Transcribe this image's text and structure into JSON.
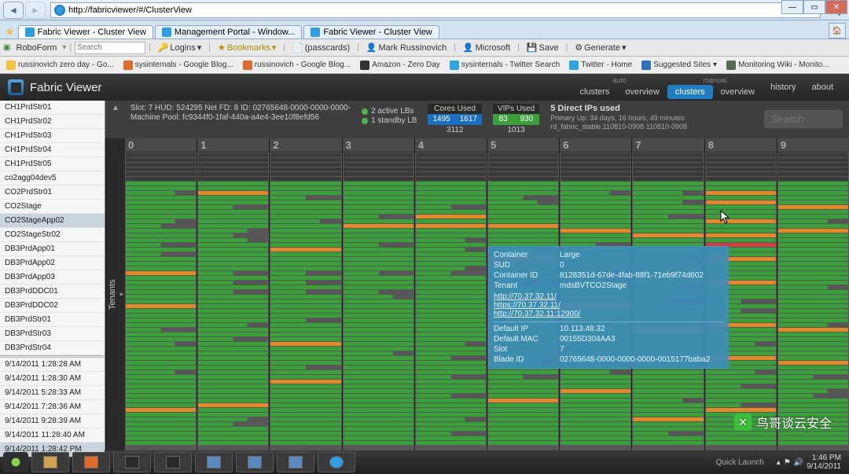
{
  "window": {
    "url": "http://fabricviewer/#/ClusterView",
    "tabs": [
      {
        "label": "Fabric Viewer - Cluster View",
        "active": true
      },
      {
        "label": "Management Portal - Window...",
        "active": false
      },
      {
        "label": "Fabric Viewer - Cluster View",
        "active": false
      }
    ]
  },
  "roboform": {
    "label": "RoboForm",
    "search_placeholder": "Search",
    "items": [
      "Logins",
      "Bookmarks",
      "(passcards)",
      "Mark Russinovich",
      "Microsoft",
      "Save",
      "Generate"
    ]
  },
  "favorites": [
    "russinovich zero day - Go...",
    "sysinternals - Google Blog...",
    "russinovich - Google Blog...",
    "Amazon - Zero Day",
    "sysinternals - Twitter Search",
    "Twitter - Home",
    "Suggested Sites",
    "Monitoring Wiki - Monito..."
  ],
  "app": {
    "title": "Fabric Viewer",
    "nav": {
      "auto_label": "auto",
      "manual_label": "manual",
      "clusters1": "clusters",
      "overview1": "overview",
      "clusters2": "clusters",
      "overview2": "overview",
      "history": "history",
      "about": "about"
    }
  },
  "sidebar": {
    "clusters": [
      "CH1PrdStr01",
      "CH1PrdStr02",
      "CH1PrdStr03",
      "CH1PrdStr04",
      "CH1PrdStr05",
      "co2agg04dev5",
      "CO2PrdStr01",
      "CO2Stage",
      "CO2StageApp02",
      "CO2StageStr02",
      "DB3PrdApp01",
      "DB3PrdApp02",
      "DB3PrdApp03",
      "DB3PrdDDC01",
      "DB3PrdDDC02",
      "DB3PrdStr01",
      "DB3PrdStr03",
      "DB3PrdStr04"
    ],
    "selected": "CO2StageApp02",
    "logs": [
      "9/14/2011 1:28:28 AM",
      "9/14/2011 1:28:30 AM",
      "9/14/2011 5:28:33 AM",
      "9/14/2011 7:28:36 AM",
      "9/14/2011 9:28:39 AM",
      "9/14/2011 11:28:40 AM",
      "9/14/2011 1:28:42 PM"
    ],
    "log_selected": "9/14/2011 1:28:42 PM"
  },
  "stats": {
    "slot_text": "Slot: 7   HUD: 524295   Net FD: 8   ID: 02765648-0000-0000-0000-",
    "machine_pool": "Machine Pool: fc9344f0-1faf-440a-a4e4-3ee10f8efd56",
    "lbs": {
      "active": "2 active LBs",
      "standby": "1 standby LB"
    },
    "cores": {
      "label": "Cores Used",
      "a": "1495",
      "b": "1617",
      "total": "3112"
    },
    "vips": {
      "label": "VIPs Used",
      "a": "83",
      "b": "930",
      "total": "1013"
    },
    "direct_ips": "5 Direct IPs used",
    "uptime": "Primary Up: 34 days, 16 hours, 49 minutes",
    "build": "rd_fabric_stable.110810-0908 110810-0908",
    "search_placeholder": "Search"
  },
  "grid": {
    "tab_label": "Tenants",
    "columns": [
      "0",
      "1",
      "2",
      "3",
      "4",
      "5",
      "6",
      "7",
      "8",
      "9"
    ]
  },
  "tooltip": {
    "container_lbl": "Container",
    "container_val": "Large",
    "sud_lbl": "SUD",
    "sud_val": "0",
    "cid_lbl": "Container ID",
    "cid_val": "8128351d-67de-4fab-88f1-71eb9f74d602",
    "tenant_lbl": "Tenant",
    "tenant_val": "mdsBVTCO2Stage",
    "links": [
      "http://70.37.32.11/",
      "https://70.37.32.11/",
      "http://70.37.32.11:12900/"
    ],
    "dip_lbl": "Default IP",
    "dip_val": "10.113.48.32",
    "dmac_lbl": "Default MAC",
    "dmac_val": "00155D304AA3",
    "slot_lbl": "Slot",
    "slot_val": "7",
    "bid_lbl": "Blade ID",
    "bid_val": "02765648-0000-0000-0000-0015177baba2"
  },
  "taskbar": {
    "quick_launch": "Quick Launch",
    "time": "1:46 PM",
    "date": "9/14/2011"
  },
  "watermark": "鸟哥谈云安全"
}
